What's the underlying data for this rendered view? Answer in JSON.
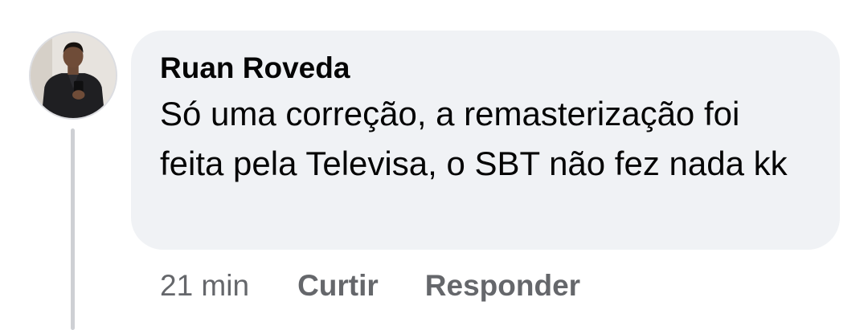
{
  "comment": {
    "author": "Ruan Roveda",
    "text": "Só uma correção, a remasterização foi feita pela Televisa, o SBT não fez nada kk",
    "timestamp": "21 min",
    "like_label": "Curtir",
    "reply_label": "Responder"
  }
}
